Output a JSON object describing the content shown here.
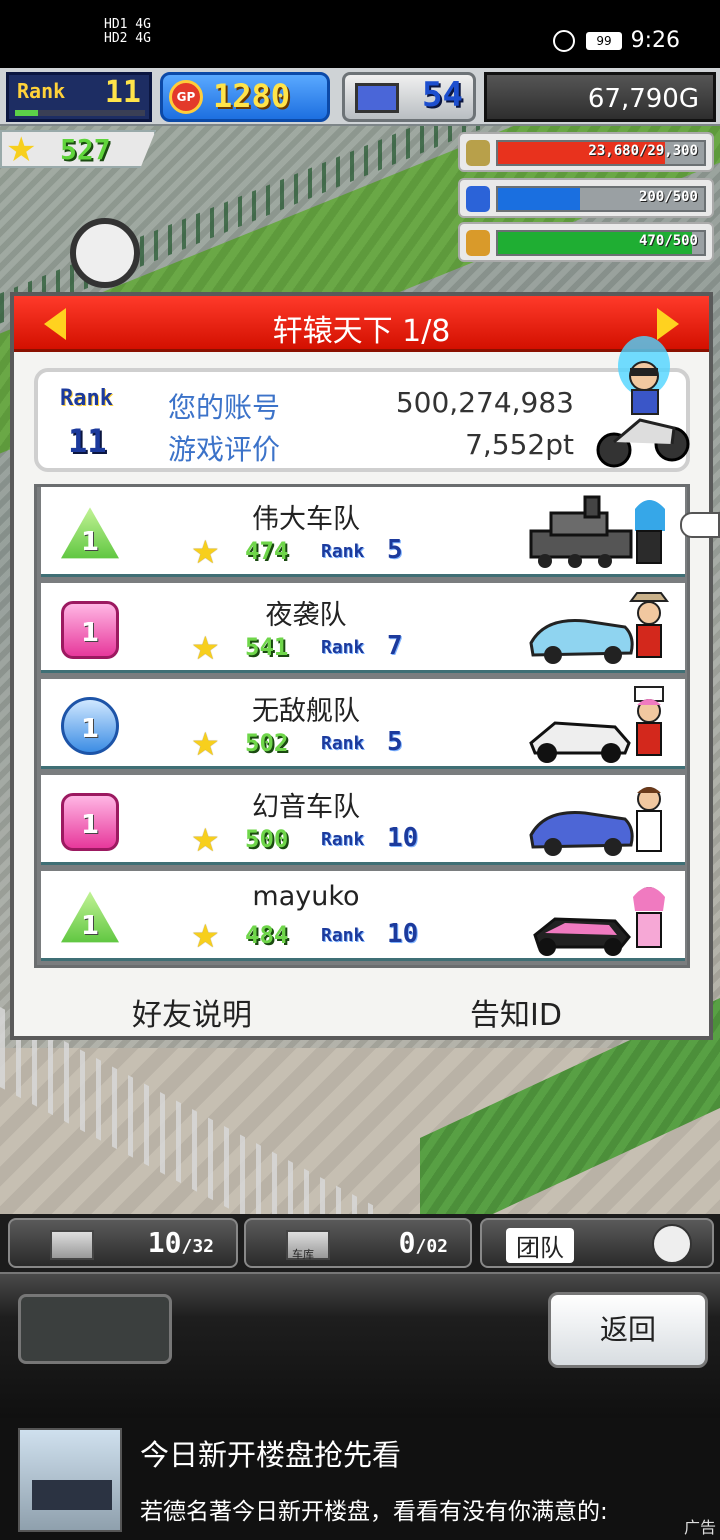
{
  "status_bar": {
    "network_line1": "HD1 4G",
    "network_line2": "HD2 4G",
    "battery": "99",
    "time": "9:26"
  },
  "hud": {
    "rank_label": "Rank",
    "rank_value": "11",
    "rank_progress": 0.18,
    "gp_icon": "GP",
    "gp_value": "1280",
    "pc_value": "54",
    "money": "67,790G",
    "stars": "527",
    "meters": [
      {
        "icon": "coin-stack-icon",
        "text": "23,680/29,300",
        "fraction": 0.81,
        "color": "#e8321d"
      },
      {
        "icon": "fuel-bottle-icon",
        "text": "200/500",
        "fraction": 0.4,
        "color": "#1a6fe0"
      },
      {
        "icon": "wheat-icon",
        "text": "470/500",
        "fraction": 0.94,
        "color": "#1fae33"
      }
    ]
  },
  "dialog": {
    "title": "轩辕天下 1/8",
    "account": {
      "rank_label": "Rank",
      "rank_value": "11",
      "label1": "您的账号",
      "value1": "500,274,983",
      "label2": "游戏评价",
      "value2": "7,552pt"
    },
    "teams": [
      {
        "badge": "1",
        "shape": "tri",
        "name": "伟大车队",
        "score": "474",
        "rank_label": "Rank",
        "rank": "5"
      },
      {
        "badge": "1",
        "shape": "sq",
        "name": "夜袭队",
        "score": "541",
        "rank_label": "Rank",
        "rank": "7"
      },
      {
        "badge": "1",
        "shape": "ci",
        "name": "无敌舰队",
        "score": "502",
        "rank_label": "Rank",
        "rank": "5"
      },
      {
        "badge": "1",
        "shape": "sq",
        "name": "幻音车队",
        "score": "500",
        "rank_label": "Rank",
        "rank": "10"
      },
      {
        "badge": "1",
        "shape": "tri",
        "name": "mayuko",
        "score": "484",
        "rank_label": "Rank",
        "rank": "10"
      }
    ],
    "footer_left": "好友说明",
    "footer_right": "告知ID"
  },
  "tabs": {
    "items_count": "10",
    "items_max": "32",
    "garage_label": "车库",
    "garage_count": "0",
    "garage_max": "02",
    "team_label": "团队"
  },
  "panel": {
    "back_label": "返回"
  },
  "ad": {
    "title": "今日新开楼盘抢先看",
    "body": "若德名著今日新开楼盘，看看有没有你满意的:",
    "tag": "广告"
  }
}
